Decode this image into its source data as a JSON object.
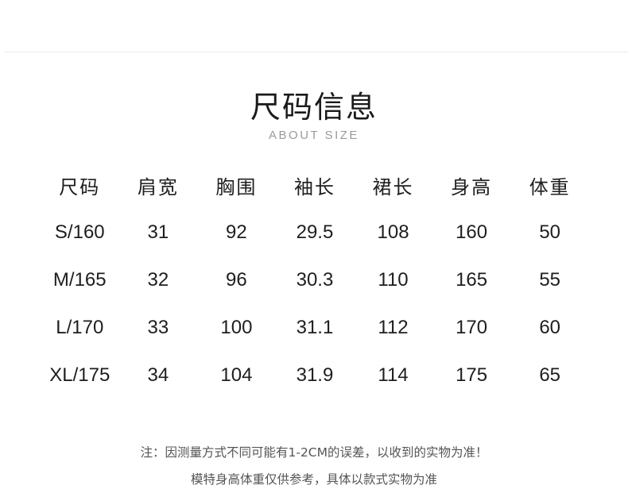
{
  "header": {
    "title": "尺码信息",
    "subtitle": "ABOUT SIZE"
  },
  "table": {
    "columns": [
      "尺码",
      "肩宽",
      "胸围",
      "袖长",
      "裙长",
      "身高",
      "体重"
    ],
    "rows": [
      [
        "S/160",
        "31",
        "92",
        "29.5",
        "108",
        "160",
        "50"
      ],
      [
        "M/165",
        "32",
        "96",
        "30.3",
        "110",
        "165",
        "55"
      ],
      [
        "L/170",
        "33",
        "100",
        "31.1",
        "112",
        "170",
        "60"
      ],
      [
        "XL/175",
        "34",
        "104",
        "31.9",
        "114",
        "175",
        "65"
      ]
    ]
  },
  "notes": {
    "line1": "注：因测量方式不同可能有1-2CM的误差，以收到的实物为准！",
    "line2": "模特身高体重仅供参考，具体以款式实物为准"
  }
}
